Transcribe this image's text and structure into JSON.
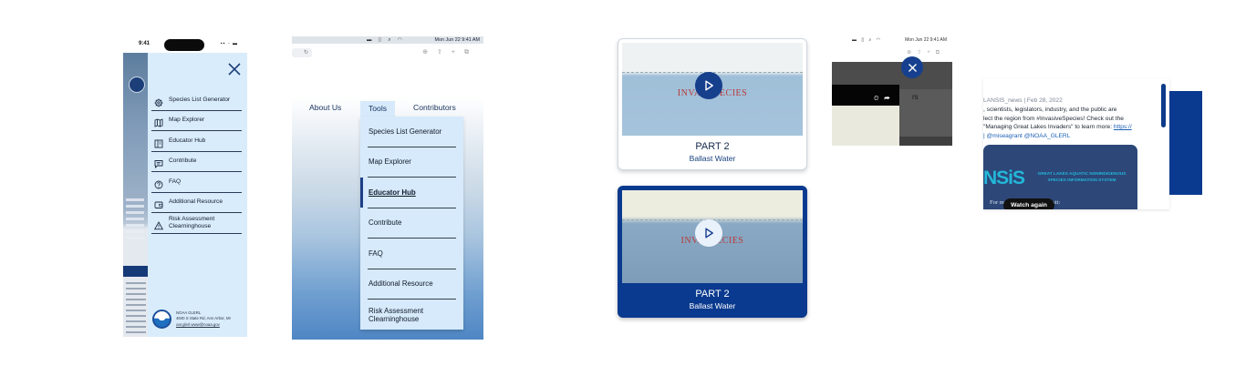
{
  "phone": {
    "time": "9:41",
    "status_icons": "▪▪ ◦ ▬",
    "menu": [
      {
        "icon": "gear-icon",
        "label": "Species List Generator"
      },
      {
        "icon": "map-icon",
        "label": "Map Explorer"
      },
      {
        "icon": "book-icon",
        "label": "Educator Hub"
      },
      {
        "icon": "message-icon",
        "label": "Contribute"
      },
      {
        "icon": "help-icon",
        "label": "FAQ"
      },
      {
        "icon": "wallet-icon",
        "label": "Additional Resource"
      },
      {
        "icon": "warning-icon",
        "label": "Risk Assessment Clearninghouse"
      }
    ],
    "footer": {
      "org": "NOAA GLERL",
      "address": "4840 S State Rd, Ann Arbor, MI",
      "email": "oar.glerl.www@noaa.gov"
    }
  },
  "tablet": {
    "status_text": "Mon Jun 22  9:41 AM",
    "nav": {
      "about": "About Us",
      "tools": "Tools",
      "contributors": "Contributors"
    },
    "dropdown": [
      {
        "label": "Species List Generator",
        "active": false
      },
      {
        "label": "Map Explorer",
        "active": false
      },
      {
        "label": "Educator Hub",
        "active": true
      },
      {
        "label": "Contribute",
        "active": false
      },
      {
        "label": "FAQ",
        "active": false
      },
      {
        "label": "Additional Resource",
        "active": false
      },
      {
        "label": "Risk Assessment Clearninghouse",
        "active": false
      }
    ]
  },
  "video_cards": [
    {
      "title": "PART 2",
      "subtitle": "Ballast Water",
      "thumb_text": "INVASIV   ECIES",
      "state": "default"
    },
    {
      "title": "PART 2",
      "subtitle": "Ballast Water",
      "thumb_text": "INVASI    ECIES",
      "state": "selected"
    }
  ],
  "mini": {
    "status_text": "Mon Jun 22  9:41 AM",
    "partial_text": "rs"
  },
  "post": {
    "meta": "LANSIS_news | Feb 28, 2022",
    "line1": ", scientists, legislators, industry, and the public are",
    "line2": "lect the region from #InvasiveSpecies! Check out the",
    "line3": "\"Managing Great Lakes Invaders\" to learn more:",
    "link": "https://",
    "line4": "| @miseagrant @NOAA_GLERL",
    "nsis_logo": "NSiS",
    "nsis_tag": "GREAT LAKES AQUATIC NONINDIGENOUS SPECIES INFORMATION SYSTEM",
    "card_text_left": "For m",
    "card_text_right": "visit:",
    "watch_label": "Watch again"
  },
  "colors": {
    "accent": "#0a3a8f",
    "menu_bg": "#d9ecfb",
    "link": "#1a5fb4"
  }
}
